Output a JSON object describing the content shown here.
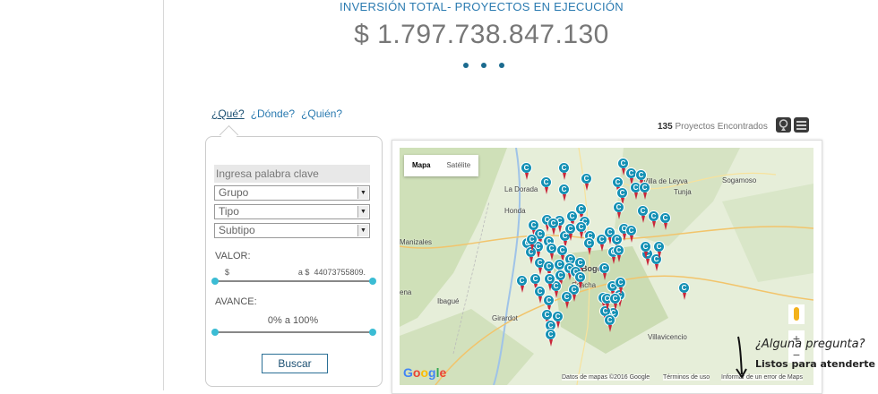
{
  "header": {
    "title": "INVERSIÓN TOTAL- PROYECTOS EN EJECUCIÓN",
    "amount": "$ 1.797.738.847.130"
  },
  "tabs": [
    {
      "label": "¿Qué?",
      "active": true
    },
    {
      "label": "¿Dónde?"
    },
    {
      "label": "¿Quién?"
    }
  ],
  "filters": {
    "keyword_placeholder": "Ingresa palabra clave",
    "grupo": "Grupo",
    "tipo": "Tipo",
    "subtipo": "Subtipo",
    "valor_label": "VALOR:",
    "valor_min": "$",
    "valor_max_prefix": "a $",
    "valor_max": "44073755809.",
    "avance_label": "AVANCE:",
    "avance_range": "0%  a  100%",
    "search_button": "Buscar"
  },
  "results": {
    "count": "135",
    "label": "Proyectos Encontrados"
  },
  "map": {
    "type_map": "Mapa",
    "type_satellite": "Satélite",
    "places": {
      "villa_de_leyva": "Villa de Leyva",
      "tunja": "Tunja",
      "sogamoso": "Sogamoso",
      "la_dorada": "La Dorada",
      "honda": "Honda",
      "manizales": "Manizales",
      "bogota": "Bogotá",
      "soacha": "Soacha",
      "ibague": "Ibagué",
      "girardot": "Girardot",
      "villavicencio": "Villavicencio",
      "ena": "ena"
    },
    "pin_letter": "C",
    "google": "Google",
    "attribution": "Datos de mapas ©2016 Google",
    "terms": "Términos de uso",
    "report": "Informar de un error de Maps",
    "zoom_in": "+",
    "zoom_out": "−"
  },
  "help": {
    "question": "¿Alguna pregunta?",
    "answer": "Listos para atenderte"
  },
  "colors": {
    "accent": "#2a7ab0",
    "pin": "#1591b5",
    "pin_tail": "#c9263a",
    "slider_knob": "#3bbcd4"
  }
}
